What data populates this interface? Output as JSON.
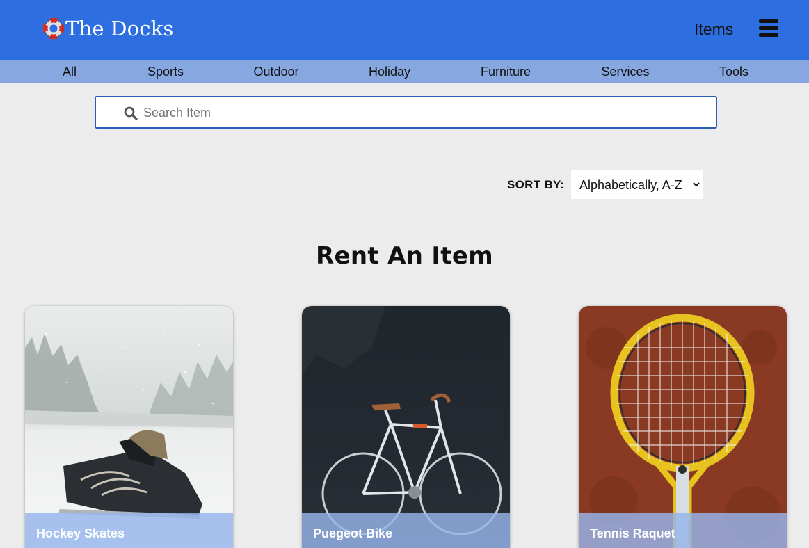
{
  "header": {
    "brand": "The Docks",
    "items_link": "Items",
    "logo_icon": "lifebuoy-icon",
    "menu_icon": "hamburger-menu-icon",
    "bg_color": "#2d6fe0"
  },
  "categories": [
    "All",
    "Sports",
    "Outdoor",
    "Holiday",
    "Furniture",
    "Services",
    "Tools"
  ],
  "search": {
    "placeholder": "Search Item",
    "icon": "search-icon"
  },
  "sort": {
    "label": "SORT BY:",
    "selected": "Alphabetically, A-Z"
  },
  "main": {
    "title": "Rent An Item"
  },
  "cards": [
    {
      "title": "Hockey Skates",
      "image": "hockey-skates-in-snow"
    },
    {
      "title": "Puegeot Bike",
      "image": "road-bike-on-dark-wall"
    },
    {
      "title": "Tennis Raquet",
      "image": "tennis-racquet-on-clay"
    }
  ]
}
